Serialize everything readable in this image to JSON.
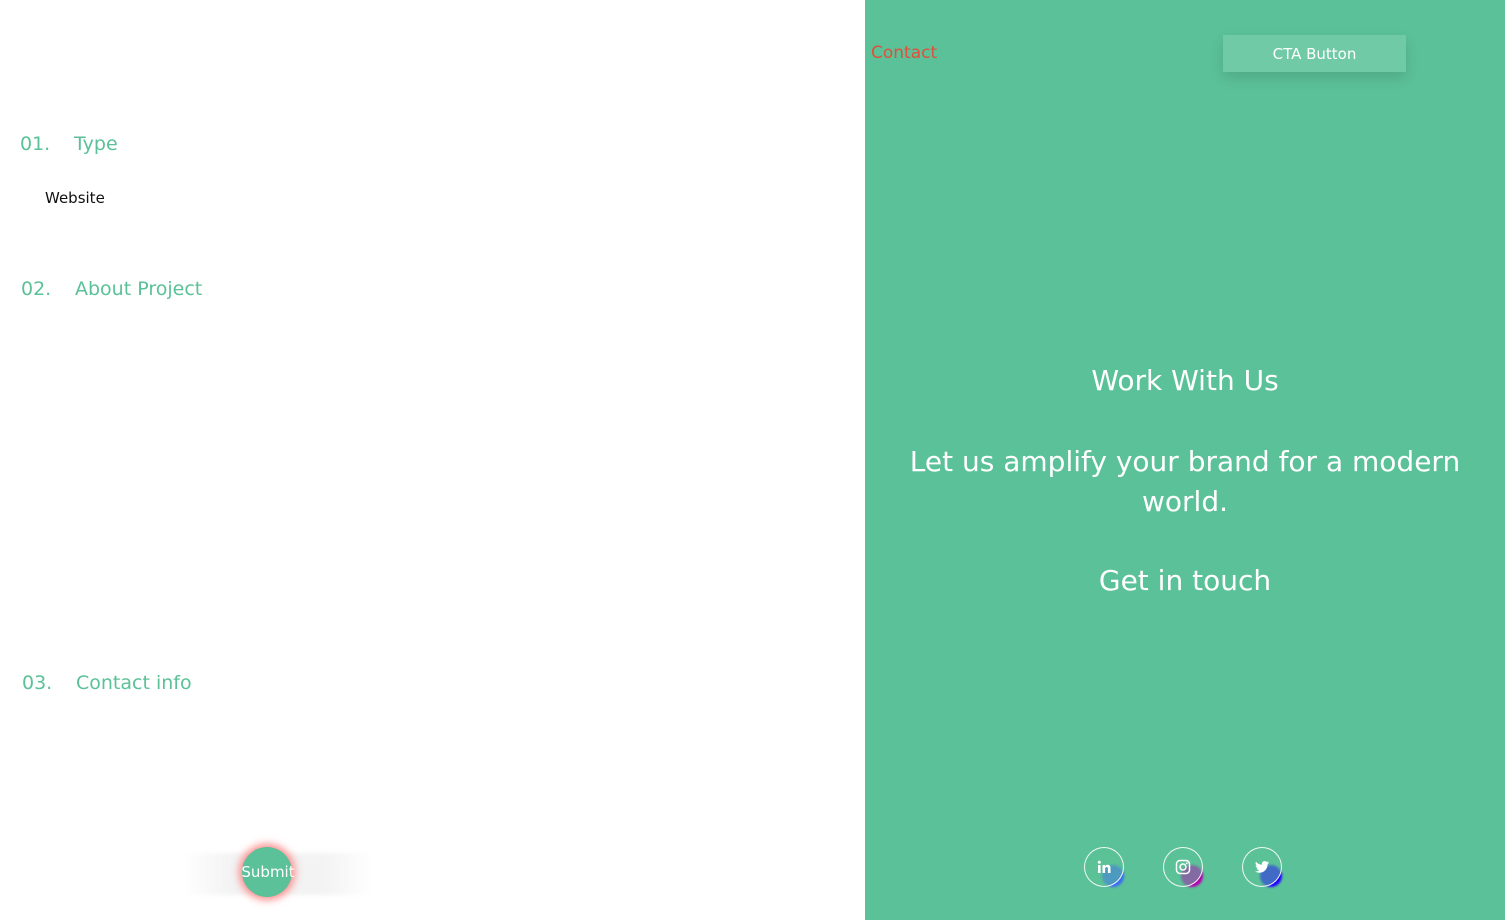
{
  "form": {
    "sections": [
      {
        "number": "01.",
        "title": "Type"
      },
      {
        "number": "02.",
        "title": "About Project"
      },
      {
        "number": "03.",
        "title": "Contact info"
      }
    ],
    "type_option": "Website",
    "submit_label": "Submit"
  },
  "header": {
    "contact_link": "Contact",
    "cta_label": "CTA Button"
  },
  "hero": {
    "heading": "Work With Us",
    "tagline": "Let us amplify your brand for a modern world.",
    "cta_text": "Get in touch"
  },
  "social": [
    {
      "name": "linkedin-icon"
    },
    {
      "name": "instagram-icon"
    },
    {
      "name": "twitter-icon"
    }
  ],
  "colors": {
    "brand_green": "#5bc198",
    "contact_link": "#e0503a",
    "text_dark": "#111111"
  }
}
